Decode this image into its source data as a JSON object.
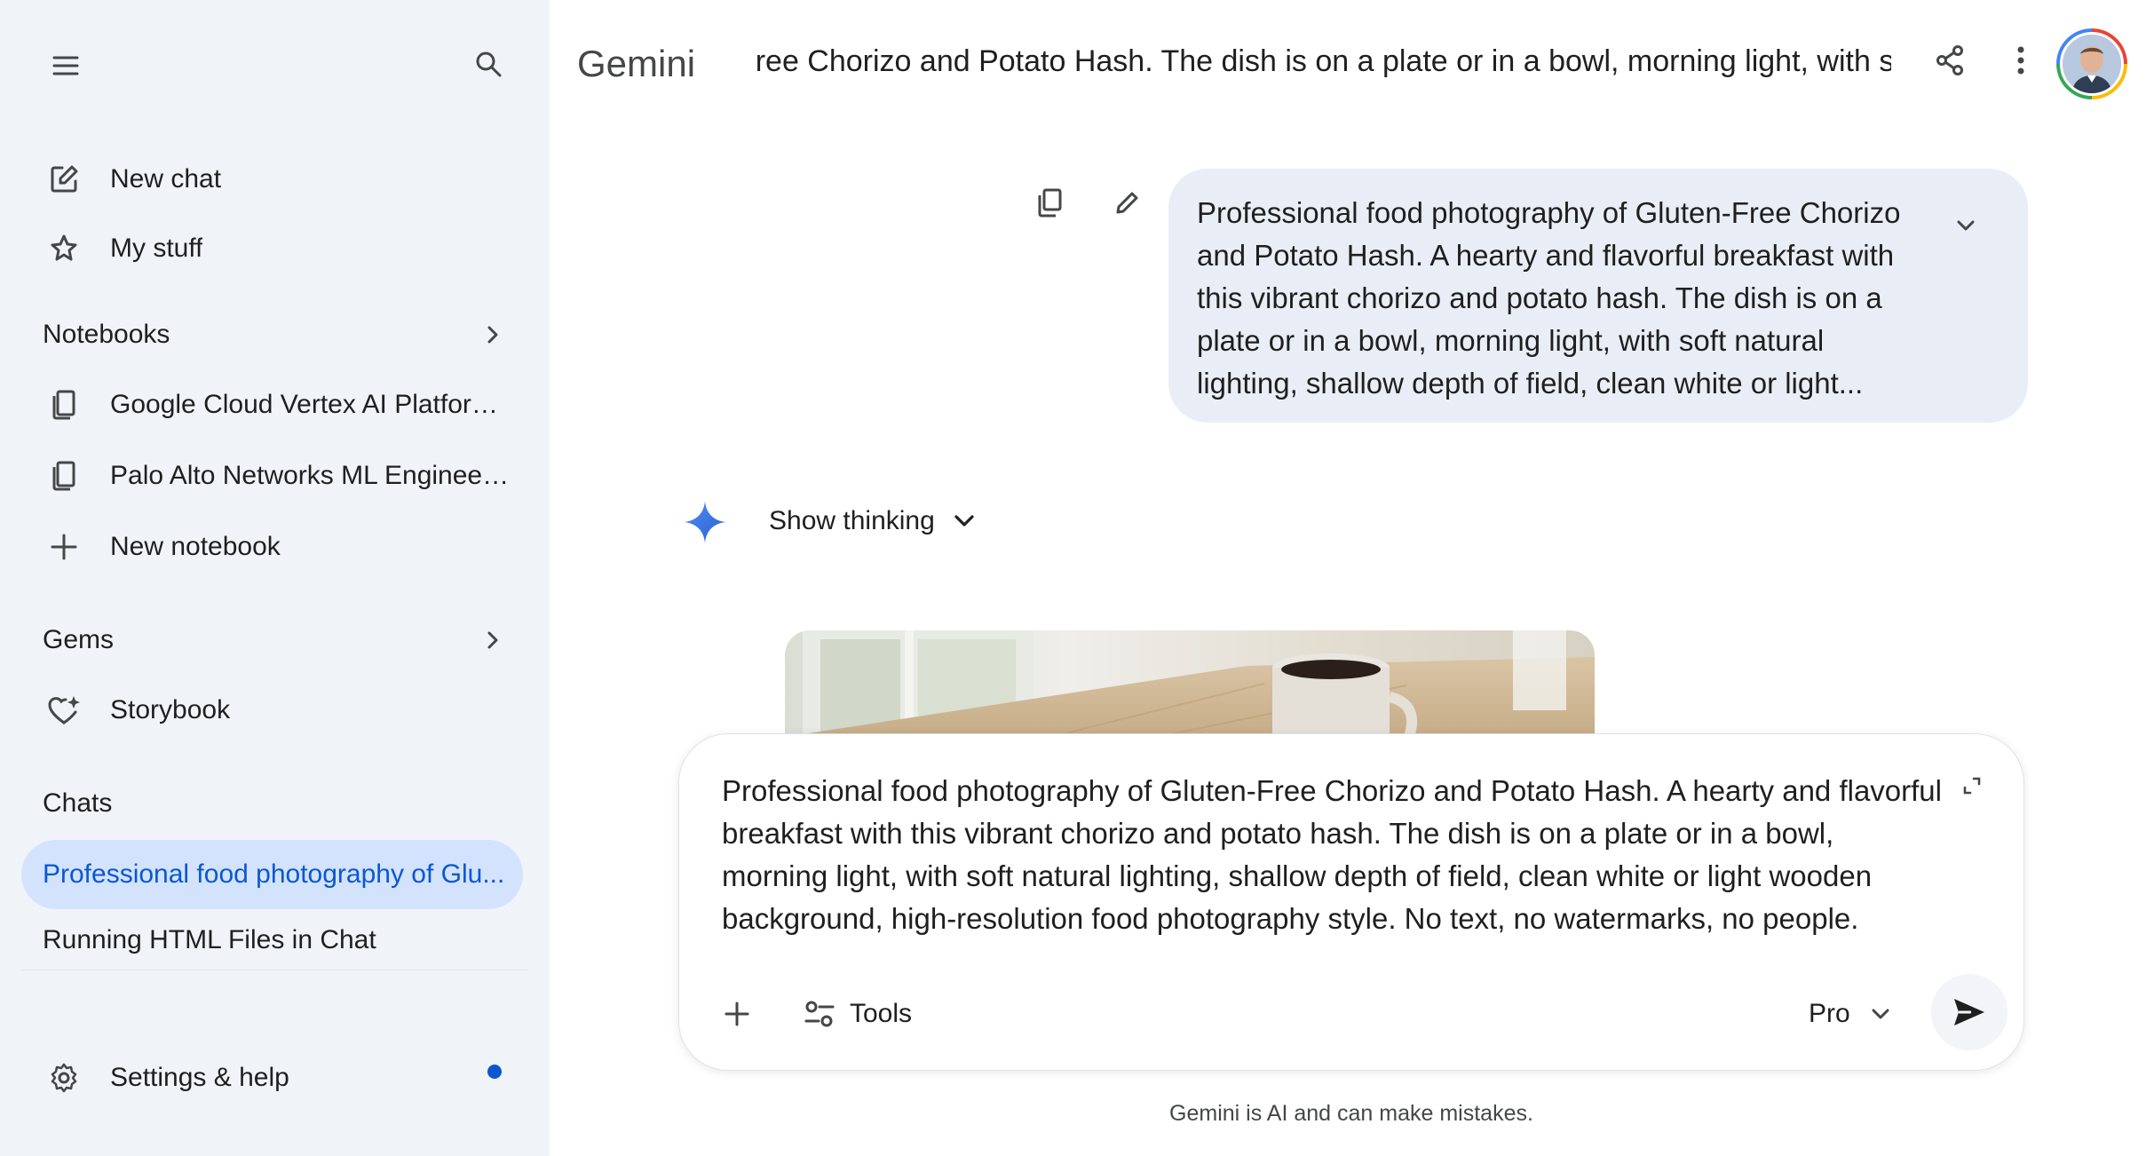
{
  "sidebar": {
    "new_chat": "New chat",
    "my_stuff": "My stuff",
    "notebooks_heading": "Notebooks",
    "notebooks": [
      {
        "label": "Google Cloud Vertex AI Platform..."
      },
      {
        "label": "Palo Alto Networks ML Engineer..."
      }
    ],
    "new_notebook": "New notebook",
    "gems_heading": "Gems",
    "gems": [
      {
        "label": "Storybook"
      }
    ],
    "chats_heading": "Chats",
    "chats": [
      {
        "label": "Professional food photography of Glu...",
        "active": true
      },
      {
        "label": "Running HTML Files in Chat",
        "active": false
      }
    ],
    "settings": "Settings & help"
  },
  "header": {
    "brand": "Gemini",
    "chat_title": "Professional food photography of Gluten-Free Chorizo and Potato Hash. The dish is on a plate or in a bowl, morning light, with soft natural lighting, shallow depth of field"
  },
  "conversation": {
    "user_prompt": "Professional food photography of Gluten-Free Chorizo and Potato Hash. A hearty and flavorful breakfast with this vibrant chorizo and potato hash. The dish is on a plate or in a bowl, morning light, with soft natural lighting, shallow depth of field, clean white or light...",
    "thinking_label": "Show thinking"
  },
  "composer": {
    "text": "Professional food photography of Gluten-Free Chorizo and Potato Hash. A hearty and flavorful breakfast with this vibrant chorizo and potato hash. The dish is on a plate or in a bowl, morning light, with soft natural lighting, shallow depth of field, clean white or light wooden background, high-resolution food photography style. No text, no watermarks, no people.",
    "tools_label": "Tools",
    "model_label": "Pro"
  },
  "disclaimer": "Gemini is AI and can make mistakes.",
  "colors": {
    "sidebar_bg": "#f0f4f9",
    "active_chat_bg": "#d3e3fd",
    "active_chat_text": "#0b57d0",
    "bubble_bg": "#e9eef6",
    "notification_dot": "#0b57d0"
  }
}
